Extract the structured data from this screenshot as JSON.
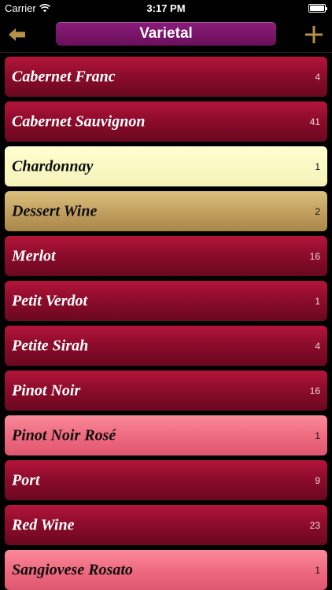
{
  "status_bar": {
    "carrier": "Carrier",
    "time": "3:17 PM"
  },
  "nav": {
    "title": "Varietal",
    "back_icon": "back-arrow-icon",
    "add_icon": "plus-icon",
    "accent_color": "#b8904a",
    "title_color": "#7a1468"
  },
  "list": {
    "items": [
      {
        "label": "Cabernet Franc",
        "count": "4",
        "style": "red"
      },
      {
        "label": "Cabernet Sauvignon",
        "count": "41",
        "style": "red"
      },
      {
        "label": "Chardonnay",
        "count": "1",
        "style": "chardonnay"
      },
      {
        "label": "Dessert Wine",
        "count": "2",
        "style": "dessert"
      },
      {
        "label": "Merlot",
        "count": "16",
        "style": "red"
      },
      {
        "label": "Petit Verdot",
        "count": "1",
        "style": "red"
      },
      {
        "label": "Petite Sirah",
        "count": "4",
        "style": "red"
      },
      {
        "label": "Pinot Noir",
        "count": "16",
        "style": "red"
      },
      {
        "label": "Pinot Noir Rosé",
        "count": "1",
        "style": "rose"
      },
      {
        "label": "Port",
        "count": "9",
        "style": "red"
      },
      {
        "label": "Red Wine",
        "count": "23",
        "style": "red"
      },
      {
        "label": "Sangiovese Rosato",
        "count": "1",
        "style": "rose"
      }
    ]
  }
}
